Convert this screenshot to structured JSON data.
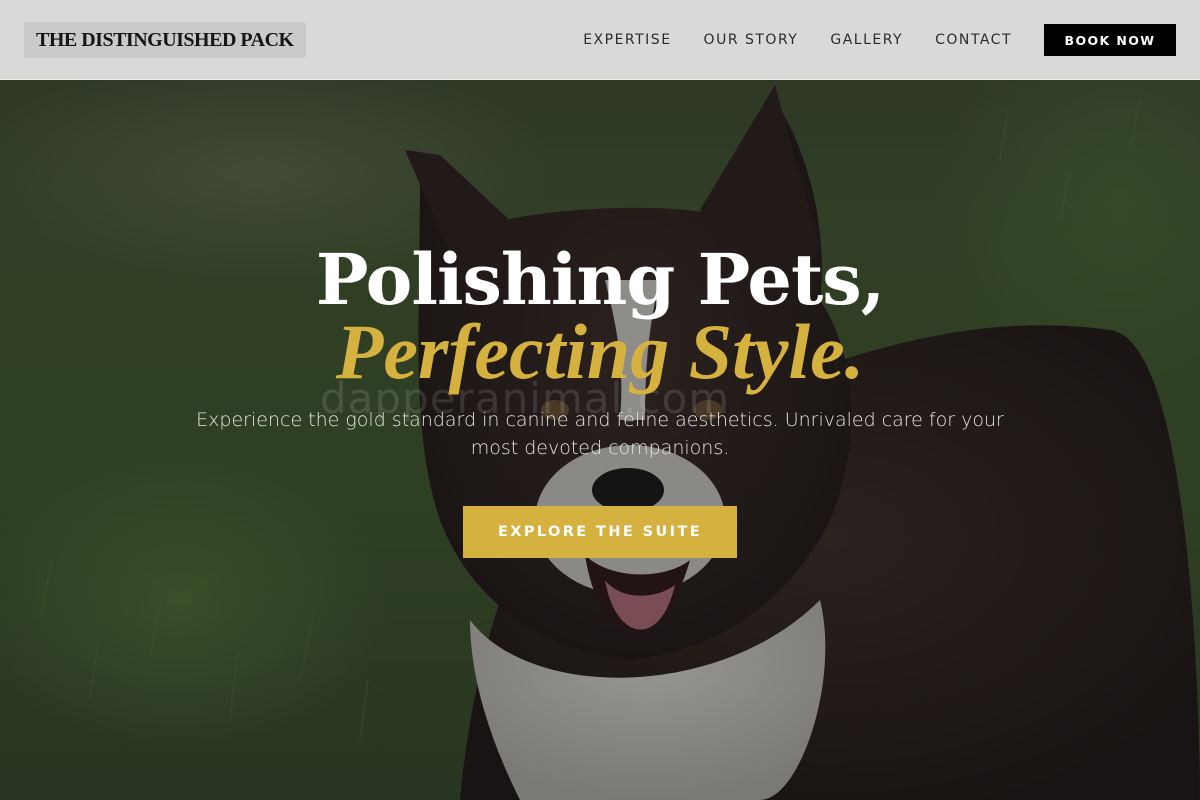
{
  "header": {
    "logo_text": "THE DISTINGUISHED PACK",
    "nav": [
      {
        "label": "EXPERTISE"
      },
      {
        "label": "OUR STORY"
      },
      {
        "label": "GALLERY"
      },
      {
        "label": "CONTACT"
      }
    ],
    "book_label": "BOOK NOW"
  },
  "hero": {
    "headline_line1": "Polishing Pets,",
    "headline_line2": "Perfecting Style.",
    "subtext": "Experience the gold standard in canine and feline aesthetics. Unrivaled care for your most devoted companions.",
    "cta_label": "EXPLORE THE SUITE",
    "watermark": "dapperanimal.com",
    "image_subject": "border-collie-photo"
  },
  "colors": {
    "accent_gold": "#d5b13f",
    "header_bg": "#e2e4e2",
    "book_button_bg": "#000000",
    "headline_white": "#ffffff"
  }
}
